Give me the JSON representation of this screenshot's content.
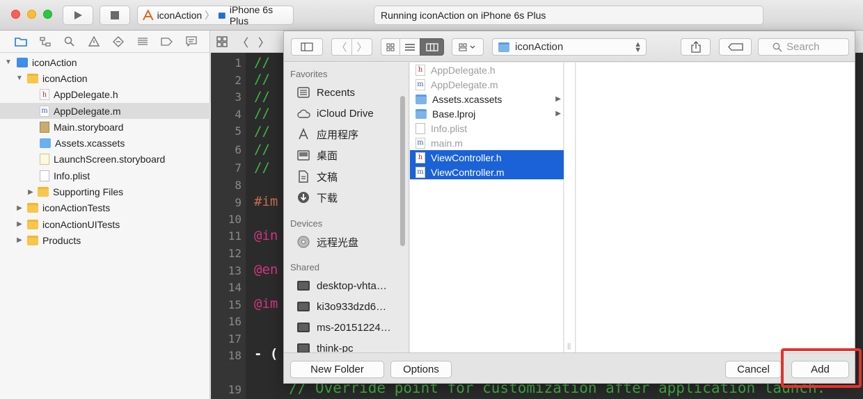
{
  "toolbar": {
    "scheme_target": "iconAction",
    "device": "iPhone 6s Plus",
    "activity_text": "Running iconAction on iPhone 6s Plus"
  },
  "navigator": {
    "tabs": [
      "folder-icon",
      "hierarchy-icon",
      "search-icon",
      "warning-icon",
      "test-icon",
      "debug-icon",
      "breakpoint-icon",
      "report-icon"
    ],
    "items": [
      {
        "label": "iconAction",
        "kind": "project",
        "level": 0,
        "expanded": true
      },
      {
        "label": "iconAction",
        "kind": "folder",
        "level": 1,
        "expanded": true
      },
      {
        "label": "AppDelegate.h",
        "kind": "h",
        "level": 2
      },
      {
        "label": "AppDelegate.m",
        "kind": "m",
        "level": 2,
        "selected": true
      },
      {
        "label": "Main.storyboard",
        "kind": "storyboard",
        "level": 2
      },
      {
        "label": "Assets.xcassets",
        "kind": "assets",
        "level": 2
      },
      {
        "label": "LaunchScreen.storyboard",
        "kind": "storyboard",
        "level": 2
      },
      {
        "label": "Info.plist",
        "kind": "plist",
        "level": 2
      },
      {
        "label": "Supporting Files",
        "kind": "folder",
        "level": 2,
        "expanded": false
      },
      {
        "label": "iconActionTests",
        "kind": "folder",
        "level": 1,
        "expanded": false
      },
      {
        "label": "iconActionUITests",
        "kind": "folder",
        "level": 1,
        "expanded": false
      },
      {
        "label": "Products",
        "kind": "folder",
        "level": 1,
        "expanded": false
      }
    ]
  },
  "editor": {
    "line_numbers": [
      "1",
      "2",
      "3",
      "4",
      "5",
      "6",
      "7",
      "8",
      "9",
      "10",
      "11",
      "12",
      "13",
      "14",
      "15",
      "16",
      "17",
      "18",
      "19"
    ],
    "code_fragments": {
      "comment": "//",
      "import": "#im",
      "interface": "@in",
      "end": "@en",
      "implementation": "@im",
      "method": "- (",
      "bottom_comment": "// Override point for customization after application launch."
    }
  },
  "dialog": {
    "location": "iconAction",
    "search_placeholder": "Search",
    "sidebar": {
      "favorites_header": "Favorites",
      "favorites": [
        {
          "label": "Recents",
          "icon": "recents-icon"
        },
        {
          "label": "iCloud Drive",
          "icon": "cloud-icon"
        },
        {
          "label": "应用程序",
          "icon": "applications-icon"
        },
        {
          "label": "桌面",
          "icon": "desktop-icon"
        },
        {
          "label": "文稿",
          "icon": "documents-icon"
        },
        {
          "label": "下载",
          "icon": "download-icon"
        }
      ],
      "devices_header": "Devices",
      "devices": [
        {
          "label": "远程光盘",
          "icon": "disc-icon"
        }
      ],
      "shared_header": "Shared",
      "shared": [
        {
          "label": "desktop-vhta…",
          "icon": "monitor-icon"
        },
        {
          "label": "ki3o933dzd6…",
          "icon": "monitor-icon"
        },
        {
          "label": "ms-20151224…",
          "icon": "monitor-icon"
        },
        {
          "label": "think-pc",
          "icon": "monitor-icon"
        }
      ]
    },
    "files": [
      {
        "label": "AppDelegate.h",
        "kind": "h",
        "dim": true
      },
      {
        "label": "AppDelegate.m",
        "kind": "m",
        "dim": true
      },
      {
        "label": "Assets.xcassets",
        "kind": "folder",
        "dim": false,
        "has_children": true
      },
      {
        "label": "Base.lproj",
        "kind": "folder",
        "dim": false,
        "has_children": true
      },
      {
        "label": "Info.plist",
        "kind": "plist",
        "dim": true
      },
      {
        "label": "main.m",
        "kind": "m",
        "dim": true
      },
      {
        "label": "ViewController.h",
        "kind": "h",
        "selected": true
      },
      {
        "label": "ViewController.m",
        "kind": "m",
        "selected": true
      }
    ],
    "buttons": {
      "new_folder": "New Folder",
      "options": "Options",
      "cancel": "Cancel",
      "add": "Add"
    }
  },
  "colors": {
    "selection": "#1a62d6",
    "highlight_box": "#e8302c",
    "comment": "#41b645",
    "keyword": "#d33682"
  }
}
